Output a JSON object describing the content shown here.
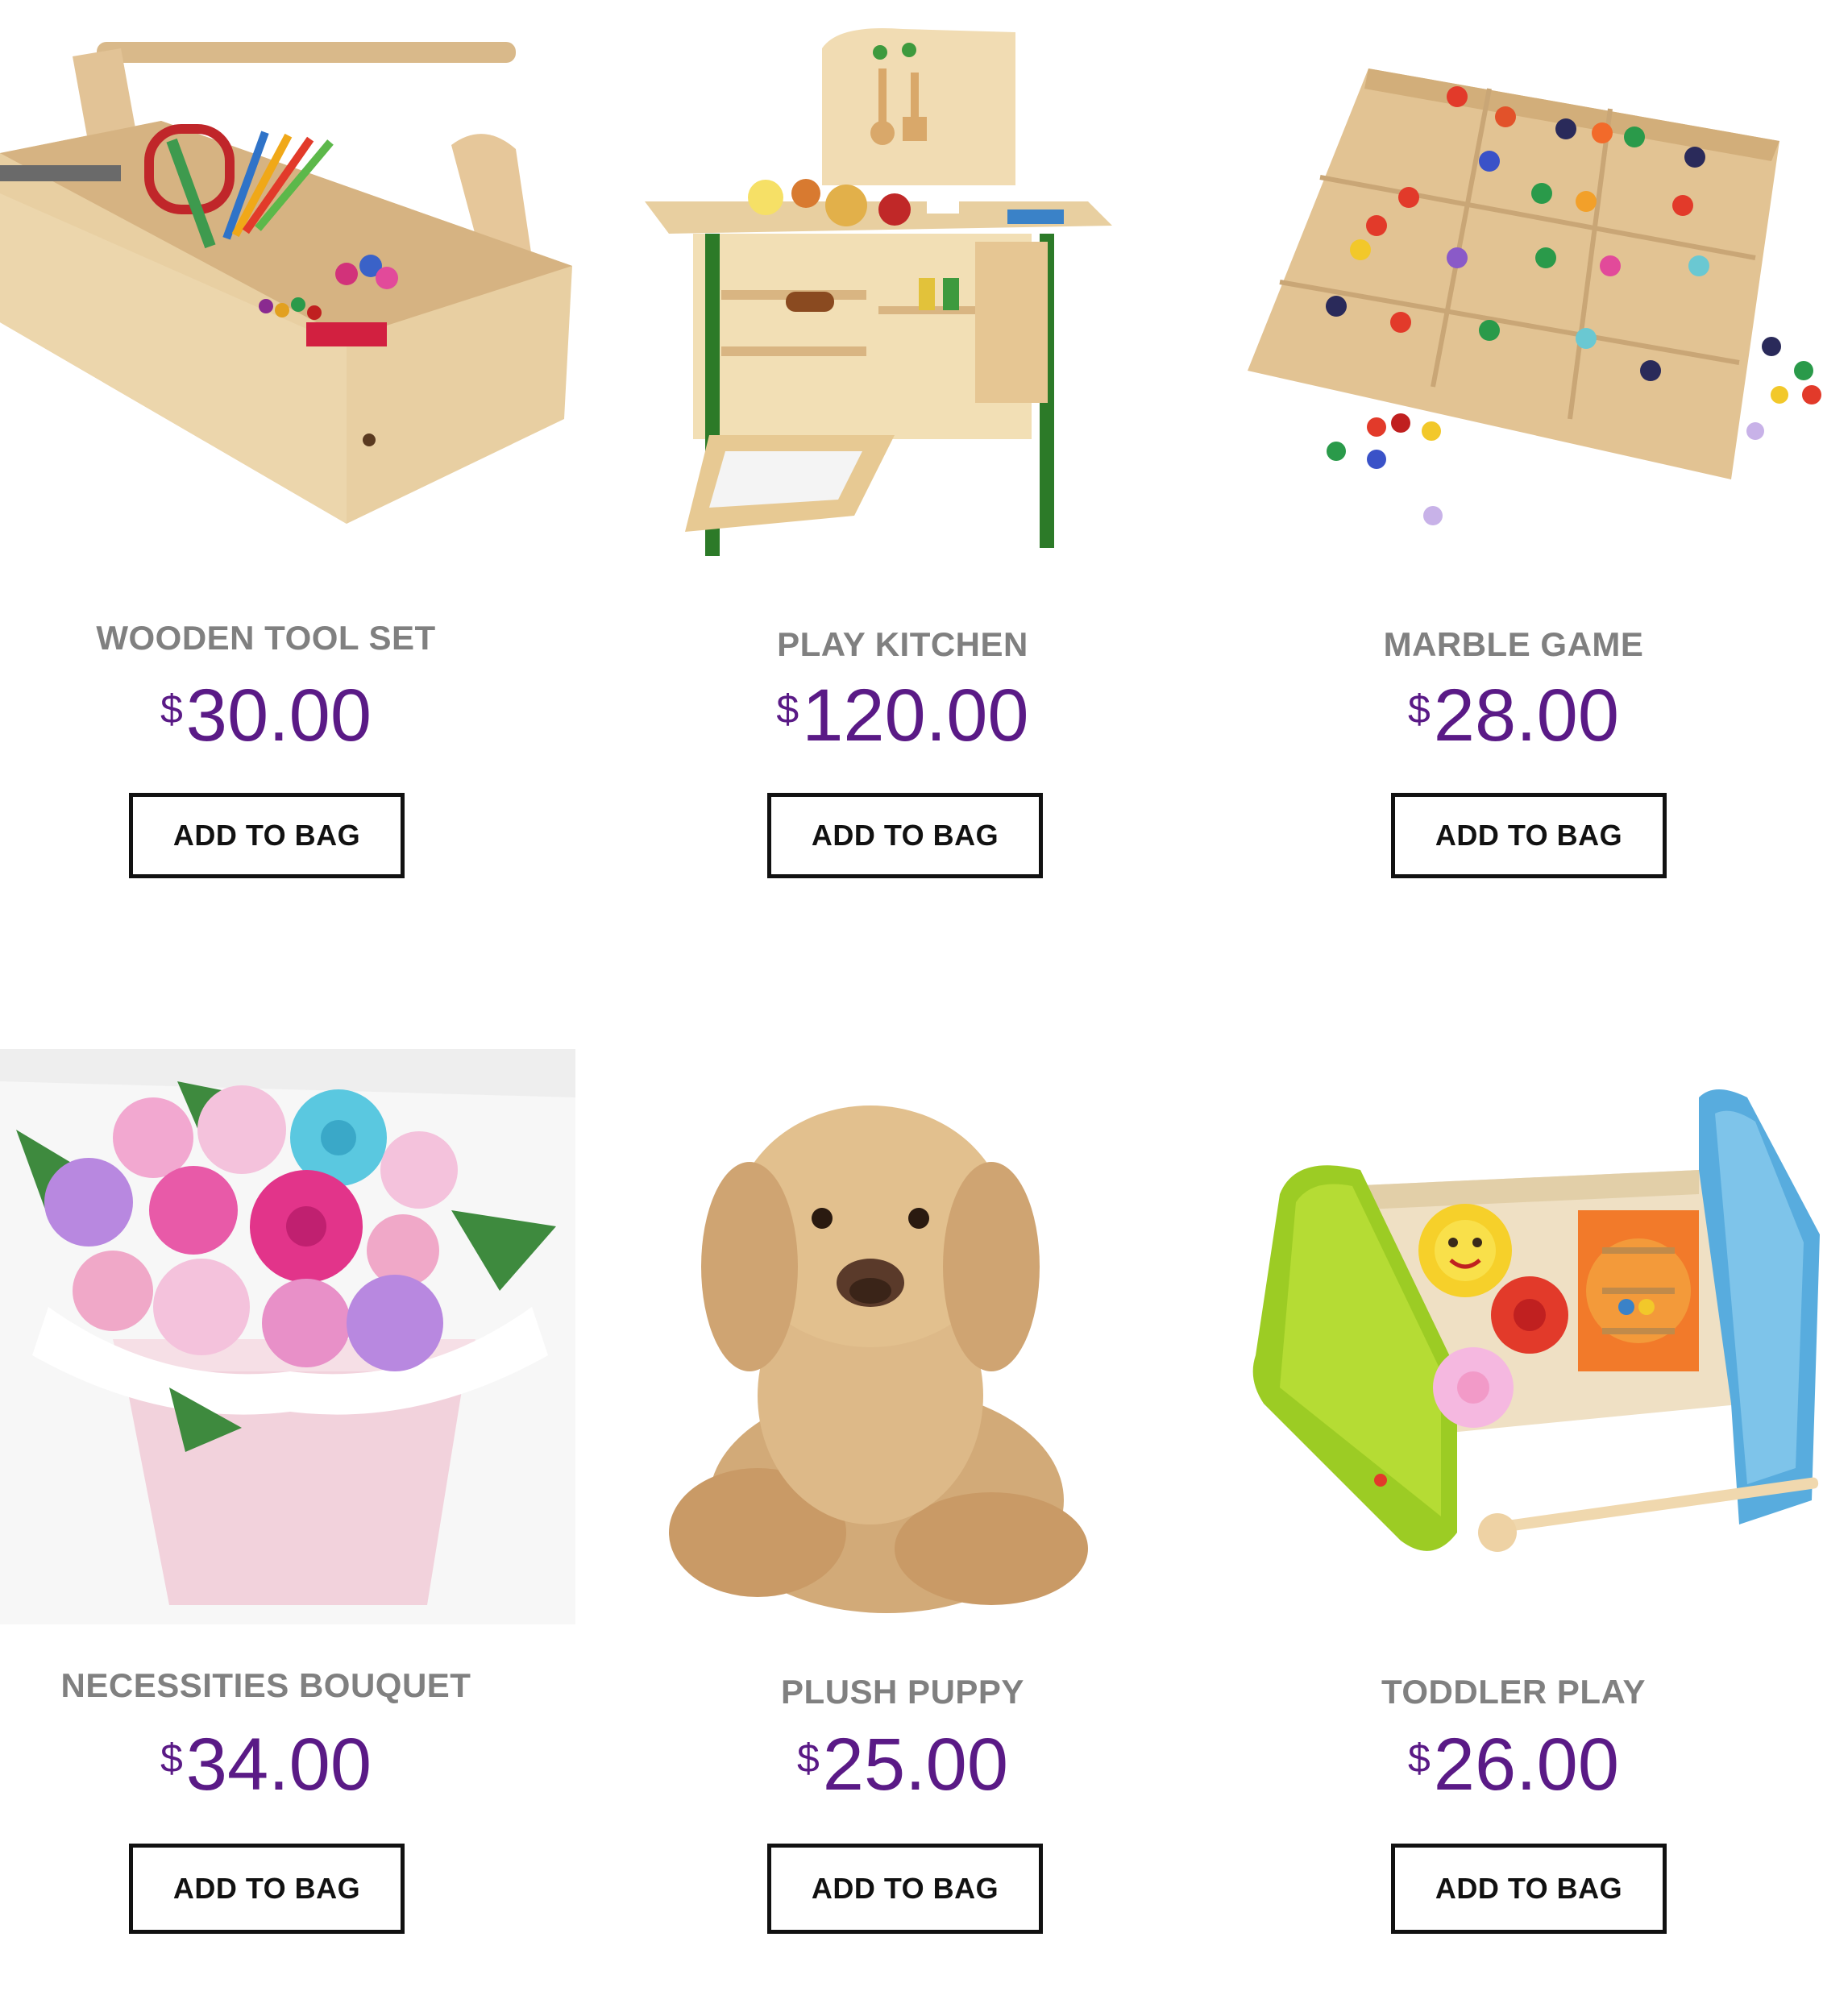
{
  "products": [
    {
      "name": "WOODEN TOOL SET",
      "currency": "$",
      "price": "30.00",
      "button": "ADD TO BAG",
      "image_icon": "wooden-tool-caddy"
    },
    {
      "name": "PLAY KITCHEN",
      "currency": "$",
      "price": "120.00",
      "button": "ADD TO BAG",
      "image_icon": "play-kitchen"
    },
    {
      "name": "MARBLE GAME",
      "currency": "$",
      "price": "28.00",
      "button": "ADD TO BAG",
      "image_icon": "marble-board"
    },
    {
      "name": "NECESSITIES BOUQUET",
      "currency": "$",
      "price": "34.00",
      "button": "ADD TO BAG",
      "image_icon": "flower-bouquet"
    },
    {
      "name": "PLUSH PUPPY",
      "currency": "$",
      "price": "25.00",
      "button": "ADD TO BAG",
      "image_icon": "plush-puppy"
    },
    {
      "name": "TODDLER PLAY",
      "currency": "$",
      "price": "26.00",
      "button": "ADD TO BAG",
      "image_icon": "toddler-activity-toy"
    }
  ],
  "colors": {
    "price": "#5a1a86",
    "name": "#808080",
    "button_border": "#111111"
  }
}
